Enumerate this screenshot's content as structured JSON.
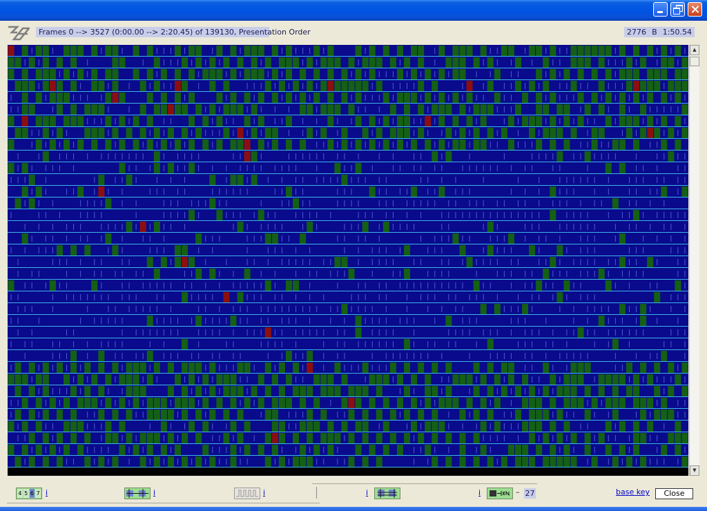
{
  "window": {
    "title": "",
    "controls": {
      "minimize": "minimize",
      "maximize": "maximize",
      "close": "close"
    }
  },
  "header": {
    "frame_range": "Frames 0 --> 3527 (0:00.00 --> 2:20.45) of 139130,  Presentation Order",
    "frame_number": "2776",
    "frame_type": "B",
    "timecode": "1:50.54"
  },
  "colors": {
    "background": "#0a0a8c",
    "i_frame": "#8b0f0f",
    "p_frame": "#146014",
    "b_frame": "#0a0a8c",
    "separator": "#3db4ea",
    "accent_box": "#c8cde8"
  },
  "icons": {
    "logo": "vs-logo-icon",
    "scroll_up": "scroll-up-arrow-icon",
    "scroll_down": "scroll-down-arrow-icon"
  },
  "toolbar": {
    "info_label": "i",
    "count_value": "27",
    "count_dash": "–",
    "base_key_label": "base key",
    "close_label": "Close",
    "digits": [
      "4",
      "5",
      "6",
      "7"
    ]
  }
}
